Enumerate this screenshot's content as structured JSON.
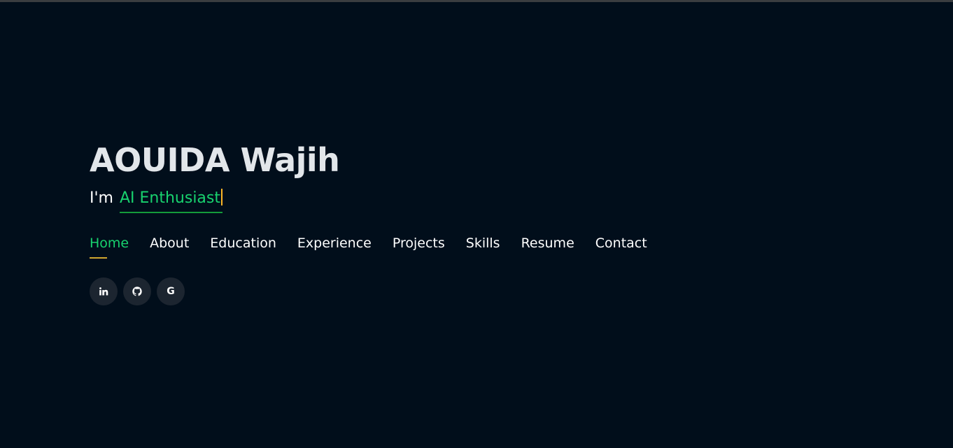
{
  "hero": {
    "name": "AOUIDA Wajih",
    "tagline_prefix": "I'm",
    "typed_text": "AI Enthusiast"
  },
  "nav": {
    "items": [
      {
        "label": "Home",
        "active": true
      },
      {
        "label": "About"
      },
      {
        "label": "Education"
      },
      {
        "label": "Experience"
      },
      {
        "label": "Projects"
      },
      {
        "label": "Skills"
      },
      {
        "label": "Resume"
      },
      {
        "label": "Contact"
      }
    ]
  },
  "social": {
    "icons": [
      "linkedin-icon",
      "github-icon",
      "google-icon"
    ],
    "google_letter": "G"
  },
  "colors": {
    "background": "#010e1b",
    "accent_green": "#18d26e",
    "accent_gold": "#d1a82f",
    "cursor": "#ffb727",
    "social_bg": "#1c2530"
  }
}
